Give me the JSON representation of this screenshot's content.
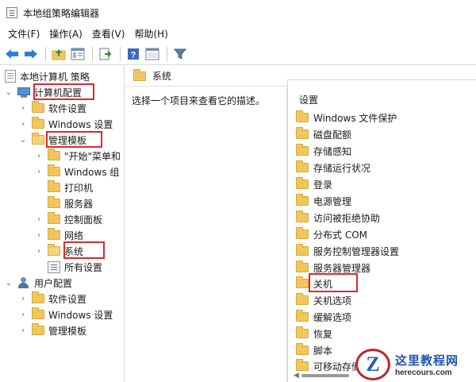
{
  "window": {
    "title": "本地组策略编辑器"
  },
  "menu": [
    "文件(F)",
    "操作(A)",
    "查看(V)",
    "帮助(H)"
  ],
  "toolbar_icons": [
    "back-icon",
    "forward-icon",
    "up-folder-icon",
    "show-hide-tree-icon",
    "export-icon",
    "help-icon",
    "properties-icon",
    "filter-icon"
  ],
  "tree": {
    "root": "本地计算机 策略",
    "computer_config": "计算机配置",
    "software_settings": "软件设置",
    "windows_settings": "Windows 设置",
    "admin_templates": "管理模板",
    "start_menu": "\"开始\"菜单和",
    "windows_components": "Windows 组",
    "printers": "打印机",
    "servers": "服务器",
    "control_panel": "控制面板",
    "network": "网络",
    "system": "系统",
    "all_settings": "所有设置",
    "user_config": "用户配置",
    "user_software_settings": "软件设置",
    "user_windows_settings": "Windows 设置",
    "user_admin_templates": "管理模板"
  },
  "right_pane": {
    "header": "系统",
    "description": "选择一个项目来查看它的描述。",
    "column_header": "设置",
    "items": [
      "Windows 文件保护",
      "磁盘配额",
      "存储感知",
      "存储运行状况",
      "登录",
      "电源管理",
      "访问被拒绝协助",
      "分布式 COM",
      "服务控制管理器设置",
      "服务器管理器",
      "关机",
      "关机选项",
      "缓解选项",
      "恢复",
      "脚本",
      "可移动存储"
    ]
  },
  "watermark": {
    "logo_letter": "Z",
    "title": "这里教程网",
    "url": "herecours.com"
  },
  "colors": {
    "highlight": "#e3262b",
    "folder": "#f0c75e",
    "watermark_blue": "#1f56b3"
  }
}
